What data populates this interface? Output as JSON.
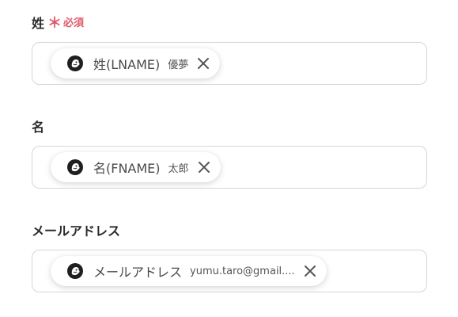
{
  "fields": [
    {
      "label": "姓",
      "required_mark": "＊",
      "required_text": "必須",
      "chip": {
        "icon": "mailchimp-icon",
        "name": "姓(LNAME)",
        "value": "優夢",
        "close_icon": "close-icon"
      }
    },
    {
      "label": "名",
      "chip": {
        "icon": "mailchimp-icon",
        "name": "名(FNAME)",
        "value": "太郎",
        "close_icon": "close-icon"
      }
    },
    {
      "label": "メールアドレス",
      "chip": {
        "icon": "mailchimp-icon",
        "name": "メールアドレス",
        "value": "yumu.taro@gmail....",
        "close_icon": "close-icon"
      }
    }
  ],
  "colors": {
    "required": "#e05a6a",
    "border": "#d6d6d6",
    "text": "#2b2b2b"
  }
}
